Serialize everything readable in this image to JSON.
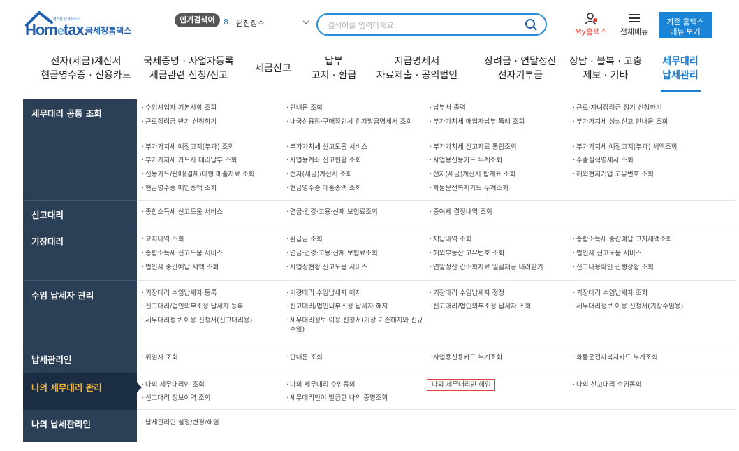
{
  "header": {
    "logo_tagline": "편리한 납세서비스",
    "logo_name": "국세청홈택스",
    "popular_label": "인기검색어",
    "popular_rank": "8.",
    "popular_term": "원천징수",
    "search_placeholder": "검색어를 입력하세요.",
    "myhome_label": "My홈택스",
    "fullmenu_label": "전체메뉴",
    "classic_line1": "기존 홈택스",
    "classic_line2": "메뉴 보기"
  },
  "gnb": [
    {
      "line1": "전자(세금)계산서",
      "line2": "현금영수증 · 신용카드"
    },
    {
      "line1": "국세증명 · 사업자등록",
      "line2": "세금관련 신청/신고"
    },
    {
      "line1": "세금신고",
      "line2": ""
    },
    {
      "line1": "납부",
      "line2": "고지 · 환급"
    },
    {
      "line1": "지급명세서",
      "line2": "자료제출 · 공익법인"
    },
    {
      "line1": "장려금 · 연말정산",
      "line2": "전자기부금"
    },
    {
      "line1": "상담 · 불복 · 고충",
      "line2": "제보 · 기타"
    },
    {
      "line1": "세무대리",
      "line2": "납세관리"
    }
  ],
  "sections": [
    {
      "title": "세무대리 공통 조회",
      "links": [
        "수임사업자 기본사항 조회",
        "안내문 조회",
        "납부서 출력",
        "근로·자녀장려금 정기 신청하기",
        "근로장려금 반기 신청하기",
        "내국신용장·구매확인서 전자발급명세서 조회",
        "부가가치세 매입자납부 특례 조회",
        "부가가치세 성실신고 안내문 조회",
        "부가가치세 예정고지(부과) 조회",
        "부가가치세 신고도움 서비스",
        "부가가치세 신고자료 통합조회",
        "부가가치세 예정고지(부과) 세액조회",
        "부가가치세 카드사 대리납부 조회",
        "사업용계좌 신고현황 조회",
        "사업용신용카드 누계조회",
        "수출실적명세서 조회",
        "신용카드/판매(결제)대행 매출자료 조회",
        "전자(세금)계산서 조회",
        "전자(세금)계산서 합계표 조회",
        "해외현지기업 고유번호 조회",
        "현금영수증 매입총액 조회",
        "현금영수증 매출총액 조회",
        "화물운전복지카드 누계조회"
      ]
    },
    {
      "title": "신고대리",
      "links": [
        "종합소득세 신고도움 서비스",
        "연금·건강·고용·산재 보험료조회",
        "증여세 결정내역 조회"
      ]
    },
    {
      "title": "기장대리",
      "links": [
        "고지내역 조회",
        "환급금 조회",
        "체납내역 조회",
        "종합소득세 중간예납 고지세액조회",
        "종합소득세 신고도움 서비스",
        "연금·건강·고용·산재 보험료조회",
        "해외부동산 고유번호 조회",
        "법인세 신고도움 서비스",
        "법인세 중간예납 세액 조회",
        "사업장현황 신고도움 서비스",
        "연말정산 간소화자료 일괄제공 내려받기",
        "신고내용확인 진행상황 조회"
      ]
    },
    {
      "title": "수임 납세자 관리",
      "links": [
        "기장대리 수임납세자 등록",
        "기장대리 수임납세자 해지",
        "기장대리 수임납세자 정정",
        "기장대리 수임납세자 조회",
        "신고대리/법인외부조정 납세자 등록",
        "신고대리/법인외부조정 납세자 해지",
        "신고대리/법인외부조정 납세자 조회",
        "세무대리정보 이용 신청서(기장수임용)",
        "세무대리정보 이용 신청서(신고대리용)",
        "세무대리정보 이용 신청서(기장 기존해지와 신규수임)"
      ]
    },
    {
      "title": "납세관리인",
      "links": [
        "위임자 조회",
        "안내문 조회",
        "사업용신용카드 누계조회",
        "화물운전자복지카드 누계조회"
      ]
    },
    {
      "title": "나의 세무대리 관리",
      "links": [
        "나의 세무대리인 조회",
        "나의 세무대리 수임동의",
        "나의 세무대리인 해임",
        "나의 신고대리 수임동의",
        "신고대리 정보이력 조회",
        "세무대리인이 발급한 나의 증명조회"
      ]
    },
    {
      "title": "나의 납세관리인",
      "links": [
        "납세관리인 설정/변경/해임"
      ]
    }
  ]
}
